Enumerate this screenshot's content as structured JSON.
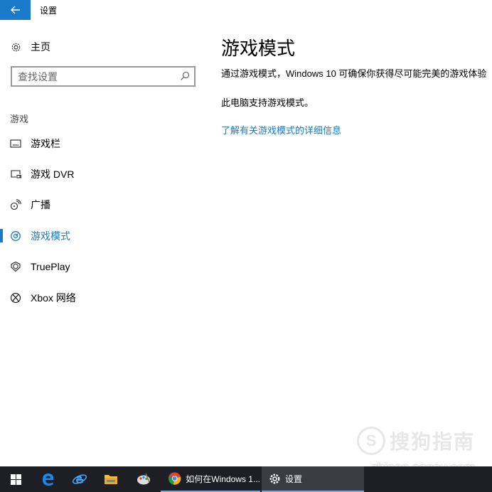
{
  "window": {
    "title": "设置"
  },
  "sidebar": {
    "home_label": "主页",
    "search": {
      "placeholder": "查找设置"
    },
    "section_label": "游戏",
    "items": [
      {
        "label": "游戏栏",
        "icon": "gamebar-icon",
        "active": false
      },
      {
        "label": "游戏 DVR",
        "icon": "dvr-icon",
        "active": false
      },
      {
        "label": "广播",
        "icon": "broadcast-icon",
        "active": false
      },
      {
        "label": "游戏模式",
        "icon": "gamemode-icon",
        "active": true
      },
      {
        "label": "TruePlay",
        "icon": "trueplay-icon",
        "active": false
      },
      {
        "label": "Xbox 网络",
        "icon": "xbox-icon",
        "active": false
      }
    ]
  },
  "main": {
    "title": "游戏模式",
    "description": "通过游戏模式，Windows 10 可确保你获得尽可能完美的游戏体验",
    "support_text": "此电脑支持游戏模式。",
    "learn_more_link": "了解有关游戏模式的详细信息"
  },
  "watermark": {
    "brand": "搜狗指南",
    "url": "zhinan.sogou.com"
  },
  "taskbar": {
    "browser_task_label": "如何在Windows 1...",
    "settings_task_label": "设置"
  },
  "colors": {
    "accent": "#1979ca",
    "taskbar": "#1d1f24"
  }
}
